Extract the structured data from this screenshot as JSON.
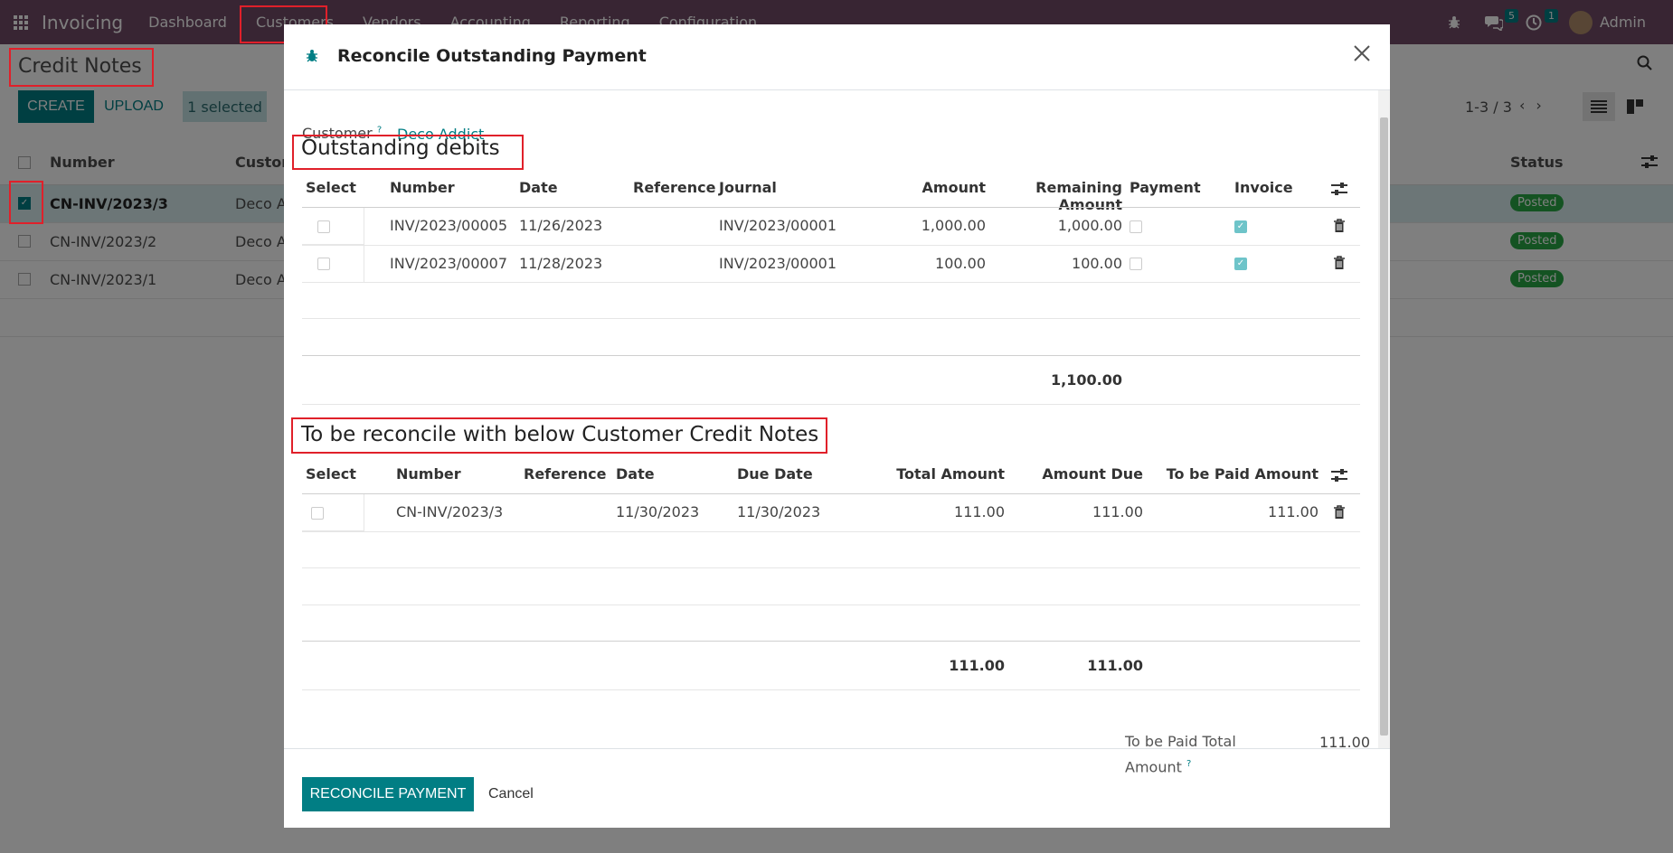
{
  "navbar": {
    "app_name": "Invoicing",
    "menu": [
      "Dashboard",
      "Customers",
      "Vendors",
      "Accounting",
      "Reporting",
      "Configuration"
    ],
    "chat_count": "5",
    "activity_count": "1",
    "user": "Admin"
  },
  "control_panel": {
    "title": "Credit Notes",
    "create_label": "CREATE",
    "upload_label": "UPLOAD",
    "selected_label": "1 selected",
    "pager": "1-3 / 3"
  },
  "list": {
    "headers": {
      "number": "Number",
      "customer": "Custom",
      "status": "Status"
    },
    "rows": [
      {
        "number": "CN-INV/2023/3",
        "customer": "Deco Ad",
        "status": "Posted",
        "checked": true
      },
      {
        "number": "CN-INV/2023/2",
        "customer": "Deco Ad",
        "status": "Posted",
        "checked": false
      },
      {
        "number": "CN-INV/2023/1",
        "customer": "Deco Ad",
        "status": "Posted",
        "checked": false
      }
    ]
  },
  "modal": {
    "title": "Reconcile Outstanding Payment",
    "customer_label": "Customer",
    "customer_help": "?",
    "customer_value": "Deco Addict",
    "debits": {
      "title": "Outstanding debits",
      "headers": {
        "select": "Select",
        "number": "Number",
        "date": "Date",
        "reference": "Reference",
        "journal": "Journal",
        "amount": "Amount",
        "remaining": "Remaining Amount",
        "payment": "Payment",
        "invoice": "Invoice"
      },
      "rows": [
        {
          "number": "INV/2023/00005",
          "date": "11/26/2023",
          "reference": "",
          "journal": "INV/2023/00001",
          "amount": "1,000.00",
          "remaining": "1,000.00",
          "payment": false,
          "invoice": true
        },
        {
          "number": "INV/2023/00007",
          "date": "11/28/2023",
          "reference": "",
          "journal": "INV/2023/00001",
          "amount": "100.00",
          "remaining": "100.00",
          "payment": false,
          "invoice": true
        }
      ],
      "total_remaining": "1,100.00"
    },
    "credits": {
      "title": "To be reconcile with below Customer Credit Notes",
      "headers": {
        "select": "Select",
        "number": "Number",
        "reference": "Reference",
        "date": "Date",
        "due_date": "Due Date",
        "total_amount": "Total Amount",
        "amount_due": "Amount Due",
        "to_pay": "To be Paid Amount"
      },
      "rows": [
        {
          "number": "CN-INV/2023/3",
          "reference": "",
          "date": "11/30/2023",
          "due_date": "11/30/2023",
          "total_amount": "111.00",
          "amount_due": "111.00",
          "to_pay": "111.00"
        }
      ],
      "total_total": "111.00",
      "total_due": "111.00"
    },
    "paid_total_label": "To be Paid Total Amount",
    "paid_total_help": "?",
    "paid_total_value": "111.00",
    "reconcile_label": "RECONCILE PAYMENT",
    "cancel_label": "Cancel"
  },
  "colors": {
    "navbar": "#714b67",
    "primary": "#017e84",
    "highlight": "#e0202a",
    "posted": "#28a745"
  }
}
